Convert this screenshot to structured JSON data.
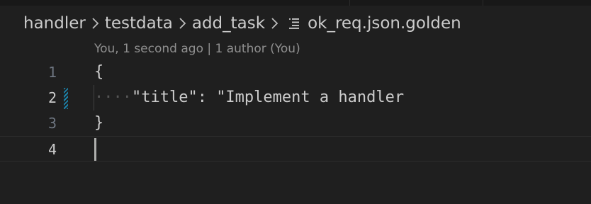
{
  "breadcrumb": {
    "items": [
      "handler",
      "testdata",
      "add_task"
    ],
    "file": "ok_req.json.golden",
    "file_icon": "file-lines-icon",
    "separator_icon": "chevron-right-icon"
  },
  "codelens": {
    "text": "You, 1 second ago | 1 author (You)"
  },
  "editor": {
    "lines": [
      {
        "number": "1",
        "code": "{"
      },
      {
        "number": "2",
        "indent": "····",
        "code": "\"title\": \"Implement a handler"
      },
      {
        "number": "3",
        "code": "}"
      },
      {
        "number": "4",
        "code": ""
      }
    ],
    "active_line": "4"
  },
  "colors": {
    "background": "#1f1f1f",
    "text": "#cccccc",
    "line_number": "#6e7681",
    "gutter_modified": "#1b81a8"
  }
}
